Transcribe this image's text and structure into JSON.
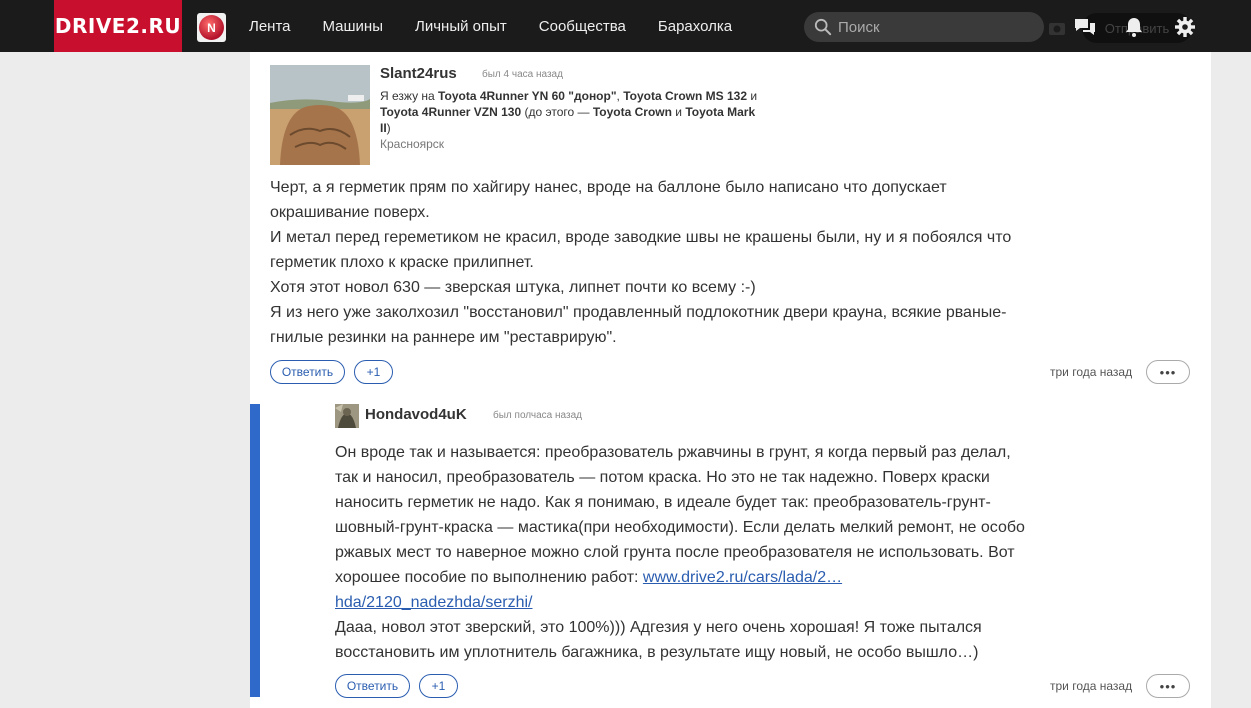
{
  "header": {
    "logo": "DRIVE2.RU",
    "avatar_letter": "N",
    "nav": [
      "Лента",
      "Машины",
      "Личный опыт",
      "Сообщества",
      "Барахолка"
    ],
    "search_placeholder": "Поиск",
    "write_label": "Отправить",
    "icons": [
      "camera-icon",
      "chat-icon",
      "bell-icon",
      "gear-icon"
    ]
  },
  "comment": {
    "author": "Slant24rus",
    "seen": "был 4 часа назад",
    "cars_prefix": "Я езжу на ",
    "car1": "Toyota 4Runner YN 60 \"донор\"",
    "sep1": ", ",
    "car2": "Toyota Crown MS 132",
    "and1": " и ",
    "car3": "Toyota 4Runner VZN 130",
    "before": " (до этого — ",
    "car4": "Toyota Crown",
    "and2": " и ",
    "car5": "Toyota Mark II",
    "after": ")",
    "city": "Красноярск",
    "lines": [
      "Черт, а я герметик прям по хайгиру нанес, вроде на баллоне было написано что допускает",
      "окрашивание поверх.",
      "И метал перед гереметиком не красил, вроде заводкие швы не крашены были, ну и я побоялся что",
      "герметик плохо к краске прилипнет.",
      "Хотя этот новол 630 — зверская штука, липнет почти ко всему :-)",
      "Я из него уже заколхозил \"восстановил\" продавленный подлокотник двери крауна, всякие рваные-",
      "гнилые резинки на раннере им \"реставрирую\"."
    ],
    "reply_label": "Ответить",
    "plus_label": "+1",
    "time": "три года назад",
    "more": "•••"
  },
  "reply": {
    "author": "Hondavod4uK",
    "seen": "был полчаса назад",
    "lines": [
      "Он вроде так и называется: преобразователь ржавчины в грунт, я когда первый раз делал,",
      "так и наносил, преобразователь — потом краска. Но это не так надежно. Поверх краски",
      "наносить герметик не надо. Как я понимаю, в идеале будет так: преобразователь-грунт-",
      "шовный-грунт-краска — мастика(при необходимости). Если делать мелкий ремонт, не особо",
      "ржавых мест то наверное можно слой грунта после преобразователя не использовать. Вот"
    ],
    "link_prefix": "хорошее пособие по выполнению работ: ",
    "link_line1": "www.drive2.ru/cars/lada/2…",
    "link_line2": "hda/2120_nadezhda/serzhi/",
    "lines2": [
      "Дааа, новол этот зверский, это 100%))) Адгезия у него очень хорошая! Я тоже пытался",
      "восстановить им уплотнитель багажника, в результате ищу новый, не особо вышло…)"
    ],
    "reply_label": "Ответить",
    "plus_label": "+1",
    "time": "три года назад",
    "more": "•••"
  }
}
